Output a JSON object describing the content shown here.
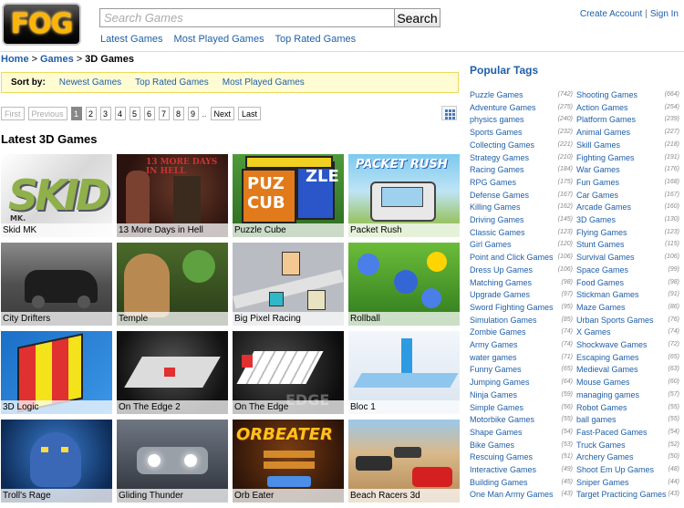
{
  "header": {
    "logo_text": "FOG",
    "search_placeholder": "Search Games",
    "search_button": "Search",
    "nav": [
      "Latest Games",
      "Most Played Games",
      "Top Rated Games"
    ],
    "account": {
      "create": "Create Account",
      "separator": "|",
      "signin": "Sign In"
    }
  },
  "breadcrumb": {
    "home": "Home",
    "games": "Games",
    "current": "3D Games",
    "separator": ">"
  },
  "sortbar": {
    "label": "Sort by:",
    "options": [
      "Newest Games",
      "Top Rated Games",
      "Most Played Games"
    ]
  },
  "pager": {
    "first": "First",
    "previous": "Previous",
    "pages": [
      "1",
      "2",
      "3",
      "4",
      "5",
      "6",
      "7",
      "8",
      "9"
    ],
    "ellipsis": "..",
    "next": "Next",
    "last": "Last",
    "current": "1"
  },
  "section_title": "Latest 3D Games",
  "games": [
    "Skid MK",
    "13 More Days in Hell",
    "Puzzle Cube",
    "Packet Rush",
    "City Drifters",
    "Temple",
    "Big Pixel Racing",
    "Rollball",
    "3D Logic",
    "On The Edge 2",
    "On The Edge",
    "Bloc 1",
    "Troll's Rage",
    "Gliding Thunder",
    "Orb Eater",
    "Beach Racers 3d"
  ],
  "popular_tags_title": "Popular Tags",
  "tags_left": [
    {
      "name": "Puzzle Games",
      "count": "(742)"
    },
    {
      "name": "Adventure Games",
      "count": "(275)"
    },
    {
      "name": "physics games",
      "count": "(240)"
    },
    {
      "name": "Sports Games",
      "count": "(232)"
    },
    {
      "name": "Collecting Games",
      "count": "(221)"
    },
    {
      "name": "Strategy Games",
      "count": "(210)"
    },
    {
      "name": "Racing Games",
      "count": "(184)"
    },
    {
      "name": "RPG Games",
      "count": "(175)"
    },
    {
      "name": "Defense Games",
      "count": "(167)"
    },
    {
      "name": "Killing Games",
      "count": "(162)"
    },
    {
      "name": "Driving Games",
      "count": "(145)"
    },
    {
      "name": "Classic Games",
      "count": "(123)"
    },
    {
      "name": "Girl Games",
      "count": "(120)"
    },
    {
      "name": "Point and Click Games",
      "count": "(106)"
    },
    {
      "name": "Dress Up Games",
      "count": "(106)"
    },
    {
      "name": "Matching Games",
      "count": "(98)"
    },
    {
      "name": "Upgrade Games",
      "count": "(97)"
    },
    {
      "name": "Sword Fighting Games",
      "count": "(95)"
    },
    {
      "name": "Simulation Games",
      "count": "(85)"
    },
    {
      "name": "Zombie Games",
      "count": "(74)"
    },
    {
      "name": "Army Games",
      "count": "(74)"
    },
    {
      "name": "water games",
      "count": "(71)"
    },
    {
      "name": "Funny Games",
      "count": "(65)"
    },
    {
      "name": "Jumping Games",
      "count": "(64)"
    },
    {
      "name": "Ninja Games",
      "count": "(59)"
    },
    {
      "name": "Simple Games",
      "count": "(56)"
    },
    {
      "name": "Motorbike Games",
      "count": "(55)"
    },
    {
      "name": "Shape Games",
      "count": "(54)"
    },
    {
      "name": "Bike Games",
      "count": "(53)"
    },
    {
      "name": "Rescuing Games",
      "count": "(51)"
    },
    {
      "name": "Interactive Games",
      "count": "(49)"
    },
    {
      "name": "Building Games",
      "count": "(45)"
    },
    {
      "name": "One Man Army Games",
      "count": "(43)"
    }
  ],
  "tags_right": [
    {
      "name": "Shooting Games",
      "count": "(664)"
    },
    {
      "name": "Action Games",
      "count": "(254)"
    },
    {
      "name": "Platform Games",
      "count": "(239)"
    },
    {
      "name": "Animal Games",
      "count": "(227)"
    },
    {
      "name": "Skill Games",
      "count": "(218)"
    },
    {
      "name": "Fighting Games",
      "count": "(191)"
    },
    {
      "name": "War Games",
      "count": "(176)"
    },
    {
      "name": "Fun Games",
      "count": "(168)"
    },
    {
      "name": "Car Games",
      "count": "(167)"
    },
    {
      "name": "Arcade Games",
      "count": "(160)"
    },
    {
      "name": "3D Games",
      "count": "(130)"
    },
    {
      "name": "Flying Games",
      "count": "(123)"
    },
    {
      "name": "Stunt Games",
      "count": "(115)"
    },
    {
      "name": "Survival Games",
      "count": "(106)"
    },
    {
      "name": "Space Games",
      "count": "(99)"
    },
    {
      "name": "Food Games",
      "count": "(98)"
    },
    {
      "name": "Stickman Games",
      "count": "(91)"
    },
    {
      "name": "Maze Games",
      "count": "(86)"
    },
    {
      "name": "Urban Sports Games",
      "count": "(76)"
    },
    {
      "name": "X Games",
      "count": "(74)"
    },
    {
      "name": "Shockwave Games",
      "count": "(72)"
    },
    {
      "name": "Escaping Games",
      "count": "(65)"
    },
    {
      "name": "Medieval Games",
      "count": "(63)"
    },
    {
      "name": "Mouse Games",
      "count": "(60)"
    },
    {
      "name": "managing games",
      "count": "(57)"
    },
    {
      "name": "Robot Games",
      "count": "(55)"
    },
    {
      "name": "ball games",
      "count": "(55)"
    },
    {
      "name": "Fast-Paced Games",
      "count": "(54)"
    },
    {
      "name": "Truck Games",
      "count": "(52)"
    },
    {
      "name": "Archery Games",
      "count": "(50)"
    },
    {
      "name": "Shoot Em Up Games",
      "count": "(48)"
    },
    {
      "name": "Sniper Games",
      "count": "(44)"
    },
    {
      "name": "Target Practicing Games",
      "count": "(43)"
    }
  ]
}
